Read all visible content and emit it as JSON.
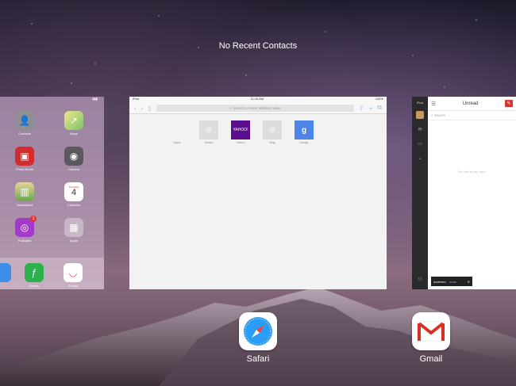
{
  "header": {
    "recent_contacts": "No Recent Contacts"
  },
  "home_card": {
    "apps": [
      {
        "label": "Contacts",
        "icon": "contacts-icon",
        "color": "#8e8e93"
      },
      {
        "label": "Maps",
        "icon": "maps-icon",
        "color": "#7bc36a"
      },
      {
        "label": "Photo Booth",
        "icon": "photo-booth-icon",
        "color": "#d22b2b"
      },
      {
        "label": "Camera",
        "icon": "camera-icon",
        "color": "#5a5a5e"
      },
      {
        "label": "Newsstand",
        "icon": "newsstand-icon",
        "color": "#6aa84f"
      },
      {
        "label": "Calendar",
        "icon": "calendar-icon",
        "color": "#ffffff",
        "day_name": "Thursday",
        "day_number": "4"
      },
      {
        "label": "Podcasts",
        "icon": "podcasts-icon",
        "color": "#a23cc8",
        "badge": "1"
      },
      {
        "label": "Apple",
        "icon": "folder-icon",
        "color": "#b8a8b8"
      }
    ],
    "dock_apps": [
      {
        "label": "Feedly",
        "icon": "feedly-icon",
        "color": "#2bb24c"
      },
      {
        "label": "Pocket",
        "icon": "pocket-icon",
        "color": "#ef4056"
      }
    ]
  },
  "safari_card": {
    "status_left": "iPad",
    "status_center": "11:16 AM",
    "status_right": "100%",
    "address_placeholder": "Search or enter website name",
    "favorites": [
      {
        "label": "Apple",
        "icon": "apple-icon"
      },
      {
        "label": "Disney",
        "icon": "compass-icon"
      },
      {
        "label": "Yahoo!",
        "icon": "yahoo-icon",
        "text": "YAHOO!"
      },
      {
        "label": "Bing",
        "icon": "compass-icon"
      },
      {
        "label": "Google",
        "icon": "google-icon",
        "text": "g"
      }
    ]
  },
  "mail_card": {
    "status_left": "iPad",
    "title": "Unread",
    "search_placeholder": "Search",
    "empty_text": "No mail to see here",
    "toast_label": "Archived",
    "toast_undo": "Undo"
  },
  "switcher": {
    "safari_label": "Safari",
    "gmail_label": "Gmail"
  }
}
